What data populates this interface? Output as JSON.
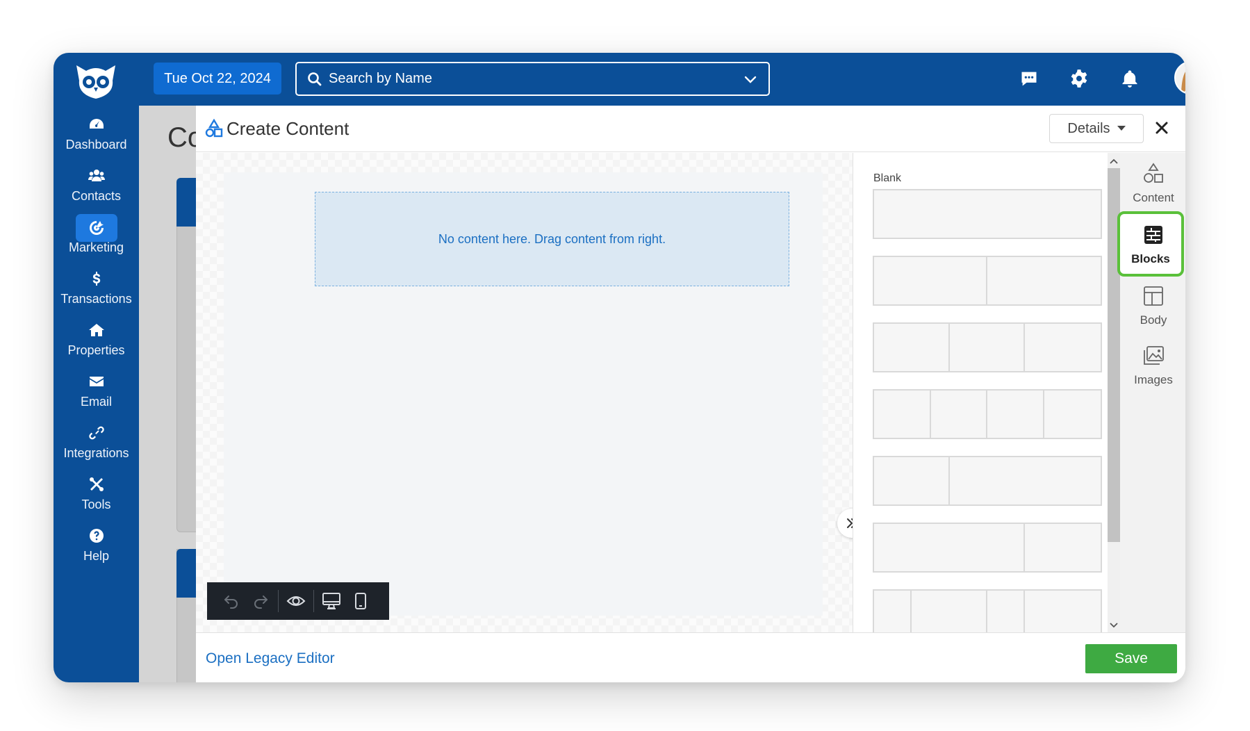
{
  "sidebar": {
    "items": [
      {
        "label": "Dashboard",
        "icon": "dashboard-icon"
      },
      {
        "label": "Contacts",
        "icon": "contacts-icon"
      },
      {
        "label": "Marketing",
        "icon": "marketing-icon"
      },
      {
        "label": "Transactions",
        "icon": "dollar-icon"
      },
      {
        "label": "Properties",
        "icon": "home-icon"
      },
      {
        "label": "Email",
        "icon": "envelope-icon"
      },
      {
        "label": "Integrations",
        "icon": "link-icon"
      },
      {
        "label": "Tools",
        "icon": "tools-icon"
      },
      {
        "label": "Help",
        "icon": "help-icon"
      }
    ],
    "active": "Marketing"
  },
  "topbar": {
    "date": "Tue Oct 22, 2024",
    "search_placeholder": "Search by Name"
  },
  "background": {
    "title_fragment": "Co"
  },
  "modal": {
    "title": "Create Content",
    "details_label": "Details",
    "drop_message": "No content here. Drag content from right.",
    "blocks": {
      "blank_label": "Blank"
    },
    "rail": [
      {
        "label": "Content",
        "icon": "shapes-icon"
      },
      {
        "label": "Blocks",
        "icon": "blocks-icon",
        "active": true
      },
      {
        "label": "Body",
        "icon": "layout-icon"
      },
      {
        "label": "Images",
        "icon": "images-icon"
      }
    ],
    "footer": {
      "legacy_link": "Open Legacy Editor",
      "save_label": "Save"
    }
  },
  "colors": {
    "brand_blue": "#0b4f98",
    "accent_blue": "#1e79df",
    "save_green": "#3eaa42",
    "active_outline": "#5ac03a"
  }
}
